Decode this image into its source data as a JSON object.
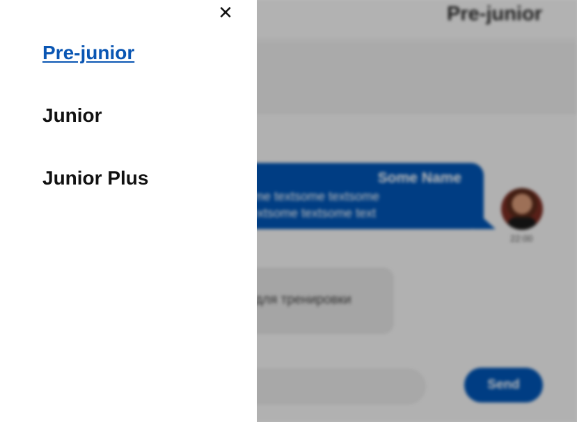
{
  "header": {
    "title": "Pre-junior"
  },
  "message_in": {
    "author": "Some Name",
    "line1": "tsome textsome textsome",
    "line2": "e textsome textsome text",
    "time": "22:00"
  },
  "message_out": {
    "text": "е для тренировки"
  },
  "composer": {
    "send_label": "Send"
  },
  "drawer": {
    "close_glyph": "✕",
    "items": [
      {
        "label": "Pre-junior",
        "active": true
      },
      {
        "label": "Junior",
        "active": false
      },
      {
        "label": "Junior Plus",
        "active": false
      }
    ]
  },
  "colors": {
    "accent": "#0054b4",
    "active_link": "#0a56b3",
    "overlay": "rgba(0,0,0,0.27)"
  }
}
